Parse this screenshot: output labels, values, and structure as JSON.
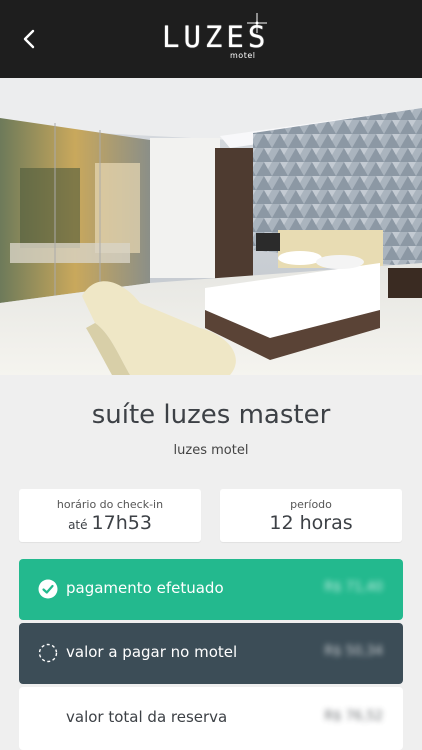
{
  "header": {
    "back_icon": "chevron-left-icon",
    "logo_word": "LUZES",
    "logo_sub": "motel"
  },
  "hero": {
    "image": "bedroom-photo"
  },
  "suite": {
    "name": "suíte luzes master",
    "motel": "luzes motel"
  },
  "checkin": {
    "label": "horário do check-in",
    "prefix": "até",
    "time": "17h53"
  },
  "period": {
    "label": "período",
    "value": "12 horas"
  },
  "payments": {
    "paid_label": "pagamento efetuado",
    "paid_amount": "R$ 71,40",
    "paid_icon": "check-circle-icon",
    "paid_color": "#23b98e",
    "due_label": "valor a pagar no motel",
    "due_amount": "R$ 50,34",
    "due_icon": "dashed-circle-icon",
    "due_color": "#3c4d57",
    "total_label": "valor total da reserva",
    "total_amount": "R$ 76,52"
  }
}
